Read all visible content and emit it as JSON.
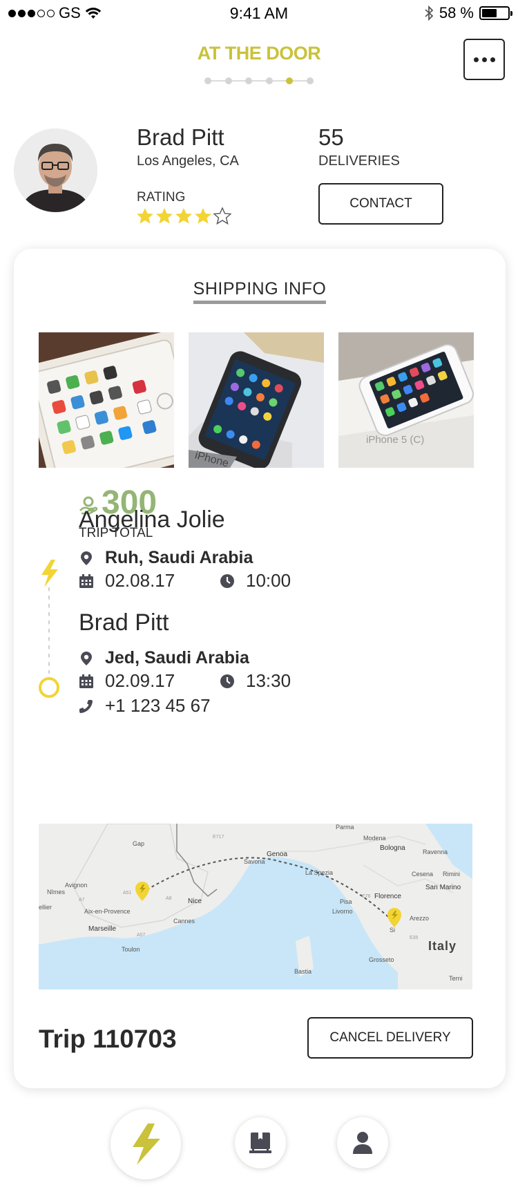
{
  "status_bar": {
    "carrier": "GS",
    "time": "9:41 AM",
    "battery_percent": "58 %",
    "battery_level": 0.58,
    "signal_bars": 3
  },
  "header": {
    "title": "AT THE DOOR",
    "steps_total": 6,
    "step_active": 5,
    "menu_icon": "more-icon"
  },
  "profile": {
    "name": "Brad Pitt",
    "location": "Los Angeles, CA",
    "rating_label": "RATING",
    "rating": 4,
    "rating_max": 5,
    "deliveries_count": "55",
    "deliveries_label": "DELIVERIES",
    "contact_label": "CONTACT"
  },
  "shipping": {
    "title": "SHIPPING INFO",
    "photo_count": 3,
    "total_value": "300",
    "total_label": "TRIP TOTAL",
    "pickup": {
      "name": "Angelina Jolie",
      "location": "Ruh, Saudi Arabia",
      "date": "02.08.17",
      "time": "10:00"
    },
    "dropoff": {
      "name": "Brad Pitt",
      "location": "Jed, Saudi Arabia",
      "date": "02.09.17",
      "time": "13:30",
      "phone": "+1 123 45 67"
    }
  },
  "map": {
    "labels": {
      "parma": "Parma",
      "modena": "Modena",
      "bologna": "Bologna",
      "ravenna": "Ravenna",
      "cesena": "Cesena",
      "rimini": "Rimini",
      "san_marino": "San Marino",
      "gap": "Gap",
      "genoa": "Genoa",
      "savona": "Savona",
      "la_spezia": "La Spezia",
      "avignon": "Avignon",
      "nimes": "Nîmes",
      "ellier": "ellier",
      "nice": "Nice",
      "cannes": "Cannes",
      "aix": "Aix-en-Provence",
      "marseille": "Marseille",
      "toulon": "Toulon",
      "pisa": "Pisa",
      "livorno": "Livorno",
      "florence": "Florence",
      "arezzo": "Arezzo",
      "italy": "Italy",
      "bastia": "Bastia",
      "grosseto": "Grosseto",
      "terni": "Terni",
      "a7": "A7",
      "e717": "E717",
      "a51": "A51",
      "a57": "A57",
      "a8": "A8",
      "e35": "E35",
      "e76": "E76",
      "si": "Si"
    }
  },
  "trip": {
    "label": "Trip 110703",
    "cancel_label": "CANCEL DELIVERY"
  },
  "colors": {
    "accent_yellow": "#c9c23a",
    "marker_yellow": "#f2d434",
    "price_green": "#94b575",
    "icon_gray": "#4a4a55",
    "sea_blue": "#c8e6f8"
  },
  "nav": {
    "items": [
      "bolt-icon",
      "box-icon",
      "user-icon"
    ]
  }
}
